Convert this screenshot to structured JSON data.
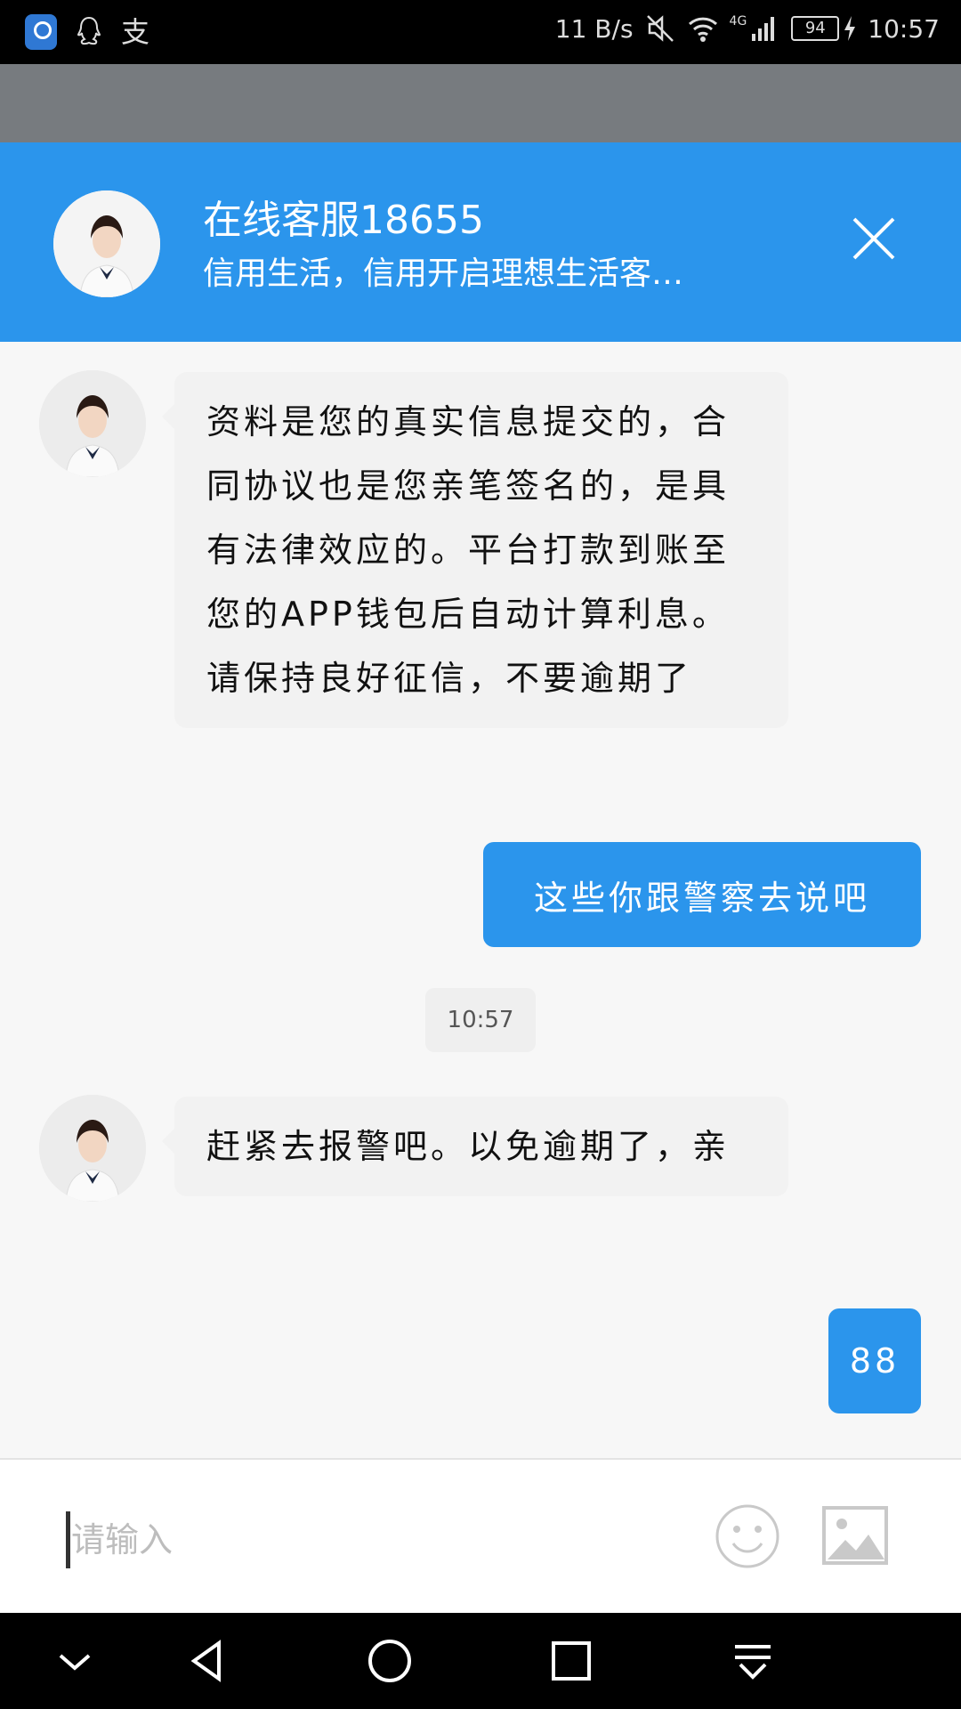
{
  "status_bar": {
    "net_speed": "11 B/s",
    "network": "4G",
    "battery": "94",
    "time": "10:57",
    "alipay_glyph": "支"
  },
  "header": {
    "title": "在线客服18655",
    "subtitle": "信用生活，信用开启理想生活客…"
  },
  "messages": [
    {
      "side": "incoming",
      "text": "资料是您的真实信息提交的，合同协议也是您亲笔签名的，是具有法律效应的。平台打款到账至您的APP钱包后自动计算利息。请保持良好征信，不要逾期了"
    },
    {
      "side": "outgoing",
      "text": "这些你跟警察去说吧"
    },
    {
      "side": "timestamp",
      "text": "10:57"
    },
    {
      "side": "incoming",
      "text": "赶紧去报警吧。以免逾期了，亲"
    },
    {
      "side": "outgoing",
      "text": "88"
    }
  ],
  "input": {
    "placeholder": "请输入"
  },
  "colors": {
    "accent": "#2b95ec",
    "bubble_in": "#f2f2f2",
    "header_band": "#777b7f"
  }
}
